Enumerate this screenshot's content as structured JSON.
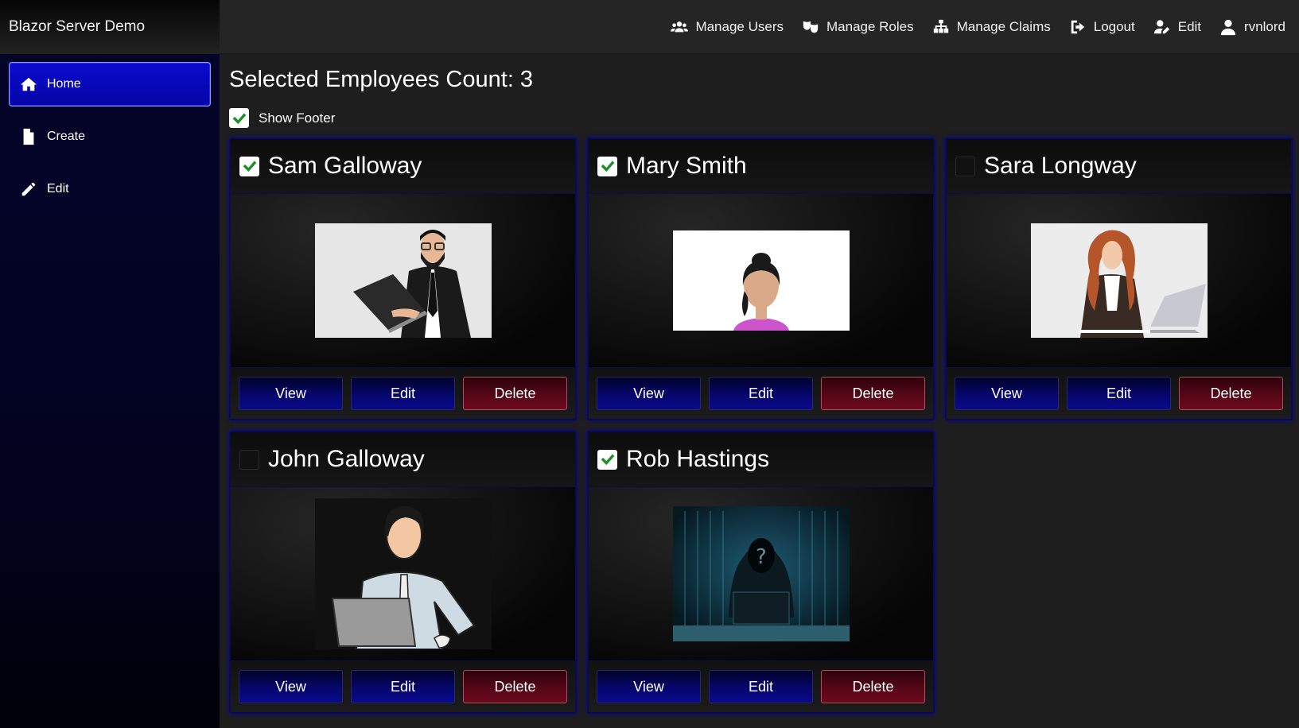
{
  "app": {
    "brand": "Blazor Server Demo"
  },
  "sidebar": {
    "items": [
      {
        "label": "Home",
        "icon": "home-icon",
        "active": true
      },
      {
        "label": "Create",
        "icon": "file-icon",
        "active": false
      },
      {
        "label": "Edit",
        "icon": "pencil-icon",
        "active": false
      }
    ]
  },
  "topbar": {
    "links": [
      {
        "label": "Manage Users",
        "icon": "users-icon"
      },
      {
        "label": "Manage Roles",
        "icon": "masks-icon"
      },
      {
        "label": "Manage Claims",
        "icon": "sitemap-icon"
      },
      {
        "label": "Logout",
        "icon": "sign-out-icon"
      },
      {
        "label": "Edit",
        "icon": "user-edit-icon"
      },
      {
        "label": "rvnlord",
        "icon": "user-icon"
      }
    ]
  },
  "main": {
    "title": "Selected Employees Count: 3",
    "show_footer": {
      "label": "Show Footer",
      "checked": true
    },
    "employees": [
      {
        "name": "Sam Galloway",
        "checked": true,
        "photo": "bearded-man-with-laptop"
      },
      {
        "name": "Mary Smith",
        "checked": true,
        "photo": "woman-avatar"
      },
      {
        "name": "Sara Longway",
        "checked": false,
        "photo": "red-haired-woman-with-laptop"
      },
      {
        "name": "John Galloway",
        "checked": false,
        "photo": "man-at-laptop"
      },
      {
        "name": "Rob Hastings",
        "checked": true,
        "photo": "hooded-hacker"
      }
    ],
    "buttons": {
      "view": "View",
      "edit": "Edit",
      "delete": "Delete"
    }
  },
  "colors": {
    "accent_blue": "#0404a6",
    "delete_red": "#5a0718",
    "check_green": "#1f8f2a"
  }
}
